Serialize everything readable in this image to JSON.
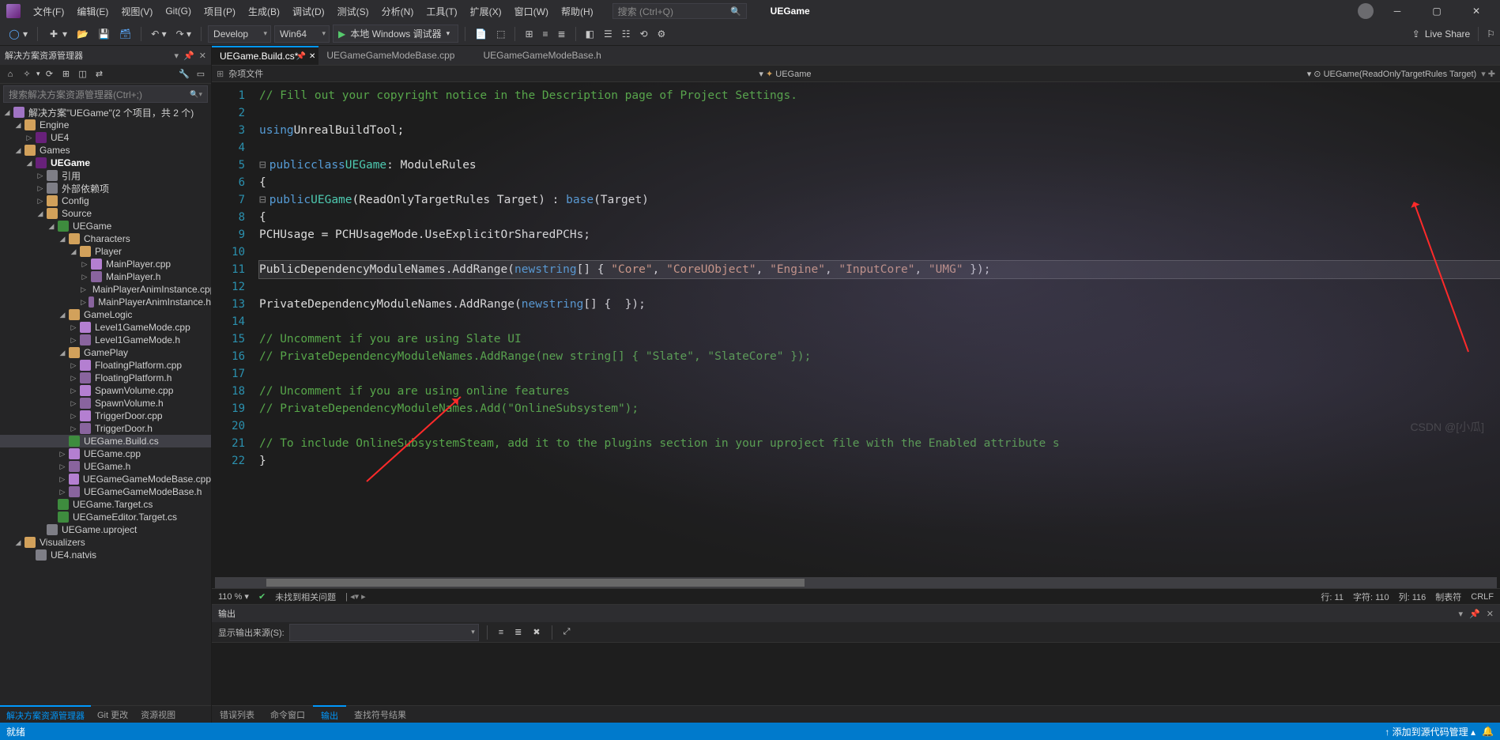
{
  "menu": {
    "items": [
      "文件(F)",
      "编辑(E)",
      "视图(V)",
      "Git(G)",
      "项目(P)",
      "生成(B)",
      "调试(D)",
      "测试(S)",
      "分析(N)",
      "工具(T)",
      "扩展(X)",
      "窗口(W)",
      "帮助(H)"
    ]
  },
  "titlebar": {
    "search_placeholder": "搜索 (Ctrl+Q)",
    "app_name": "UEGame",
    "live_share": "Live Share"
  },
  "toolbar": {
    "config": "Develop",
    "platform": "Win64",
    "debug_target": "本地 Windows 调试器"
  },
  "solution_explorer": {
    "title": "解决方案资源管理器",
    "search_placeholder": "搜索解决方案资源管理器(Ctrl+;)",
    "root": "解决方案\"UEGame\"(2 个项目，共 2 个)",
    "tree_labels": {
      "engine": "Engine",
      "ue4": "UE4",
      "games": "Games",
      "uegame": "UEGame",
      "refs": "引用",
      "external": "外部依赖项",
      "config": "Config",
      "source": "Source",
      "src_uegame": "UEGame",
      "characters": "Characters",
      "player": "Player",
      "mp_cpp": "MainPlayer.cpp",
      "mp_h": "MainPlayer.h",
      "mpa_cpp": "MainPlayerAnimInstance.cpp",
      "mpa_h": "MainPlayerAnimInstance.h",
      "gamelogic": "GameLogic",
      "l1_cpp": "Level1GameMode.cpp",
      "l1_h": "Level1GameMode.h",
      "gameplay": "GamePlay",
      "fp_cpp": "FloatingPlatform.cpp",
      "fp_h": "FloatingPlatform.h",
      "sv_cpp": "SpawnVolume.cpp",
      "sv_h": "SpawnVolume.h",
      "td_cpp": "TriggerDoor.cpp",
      "td_h": "TriggerDoor.h",
      "build_cs": "UEGame.Build.cs",
      "uegame_cpp": "UEGame.cpp",
      "uegame_h": "UEGame.h",
      "gmbase_cpp": "UEGameGameModeBase.cpp",
      "gmbase_h": "UEGameGameModeBase.h",
      "target_cs": "UEGame.Target.cs",
      "editor_target_cs": "UEGameEditor.Target.cs",
      "uproject": "UEGame.uproject",
      "visualizers": "Visualizers",
      "natvis": "UE4.natvis"
    },
    "bottom_tabs": [
      "解决方案资源管理器",
      "Git 更改",
      "资源视图"
    ]
  },
  "editor": {
    "tabs": [
      {
        "label": "UEGame.Build.cs*",
        "active": true
      },
      {
        "label": "UEGameGameModeBase.cpp",
        "active": false
      },
      {
        "label": "UEGameGameModeBase.h",
        "active": false
      }
    ],
    "breadcrumb": {
      "left": "杂项文件",
      "mid": "UEGame",
      "right": "UEGame(ReadOnlyTargetRules Target)"
    },
    "zoom": "110 %",
    "issues": "未找到相关问题",
    "caret": {
      "line_label": "行: 11",
      "char_label": "字符: 110",
      "col_label": "列: 116",
      "tabs_label": "制表符",
      "crlf": "CRLF"
    },
    "code": [
      {
        "n": 1,
        "html": "<span class='cm'>// Fill out your copyright notice in the Description page of Project Settings.</span>"
      },
      {
        "n": 2,
        "html": ""
      },
      {
        "n": 3,
        "html": "<span class='kw'>using</span> <span class='pln'>UnrealBuildTool;</span>"
      },
      {
        "n": 4,
        "html": ""
      },
      {
        "n": 5,
        "html": "<span class='fold'>⊟</span><span class='kw'>public</span> <span class='kw'>class</span> <span class='typ'>UEGame</span> <span class='pln'>: ModuleRules</span>"
      },
      {
        "n": 6,
        "html": "<span class='pln'>{</span>"
      },
      {
        "n": 7,
        "html": "<span class='fold'>⊟</span>    <span class='kw'>public</span> <span class='typ'>UEGame</span><span class='pln'>(ReadOnlyTargetRules Target) : </span><span class='kw'>base</span><span class='pln'>(Target)</span>"
      },
      {
        "n": 8,
        "html": "    <span class='pln'>{</span>"
      },
      {
        "n": 9,
        "html": "        <span class='pln'>PCHUsage = PCHUsageMode.UseExplicitOrSharedPCHs;</span>"
      },
      {
        "n": 10,
        "html": ""
      },
      {
        "n": 11,
        "html": "        <span class='pln'>PublicDependencyModuleNames.AddRange(</span><span class='kw'>new</span> <span class='kw'>string</span><span class='pln'>[] { </span><span class='str'>\"Core\"</span><span class='pln'>, </span><span class='str'>\"CoreUObject\"</span><span class='pln'>, </span><span class='str'>\"Engine\"</span><span class='pln'>, </span><span class='str'>\"InputCore\"</span><span class='pln'>, </span><span class='str'>\"UMG\"</span><span class='pln'> });</span>",
        "hl": true
      },
      {
        "n": 12,
        "html": ""
      },
      {
        "n": 13,
        "html": "        <span class='pln'>PrivateDependencyModuleNames.AddRange(</span><span class='kw'>new</span> <span class='kw'>string</span><span class='pln'>[] {  });</span>"
      },
      {
        "n": 14,
        "html": ""
      },
      {
        "n": 15,
        "html": "        <span class='cm'>// Uncomment if you are using Slate UI</span>"
      },
      {
        "n": 16,
        "html": "        <span class='cm'>// PrivateDependencyModuleNames.AddRange(new string[] { \"Slate\", \"SlateCore\" });</span>"
      },
      {
        "n": 17,
        "html": ""
      },
      {
        "n": 18,
        "html": "        <span class='cm'>// Uncomment if you are using online features</span>"
      },
      {
        "n": 19,
        "html": "        <span class='cm'>// PrivateDependencyModuleNames.Add(\"OnlineSubsystem\");</span>"
      },
      {
        "n": 20,
        "html": ""
      },
      {
        "n": 21,
        "html": "        <span class='cm'>// To include OnlineSubsystemSteam, add it to the plugins section in your uproject file with the Enabled attribute s</span>"
      },
      {
        "n": 22,
        "html": "    <span class='pln'>}</span>"
      }
    ]
  },
  "output": {
    "title": "输出",
    "source_label": "显示输出来源(S):",
    "bottom_tabs": [
      "错误列表",
      "命令窗口",
      "输出",
      "查找符号结果"
    ]
  },
  "statusbar": {
    "ready": "就绪",
    "source": "添加到源代码管理",
    "watermark": "CSDN @[小瓜]"
  }
}
